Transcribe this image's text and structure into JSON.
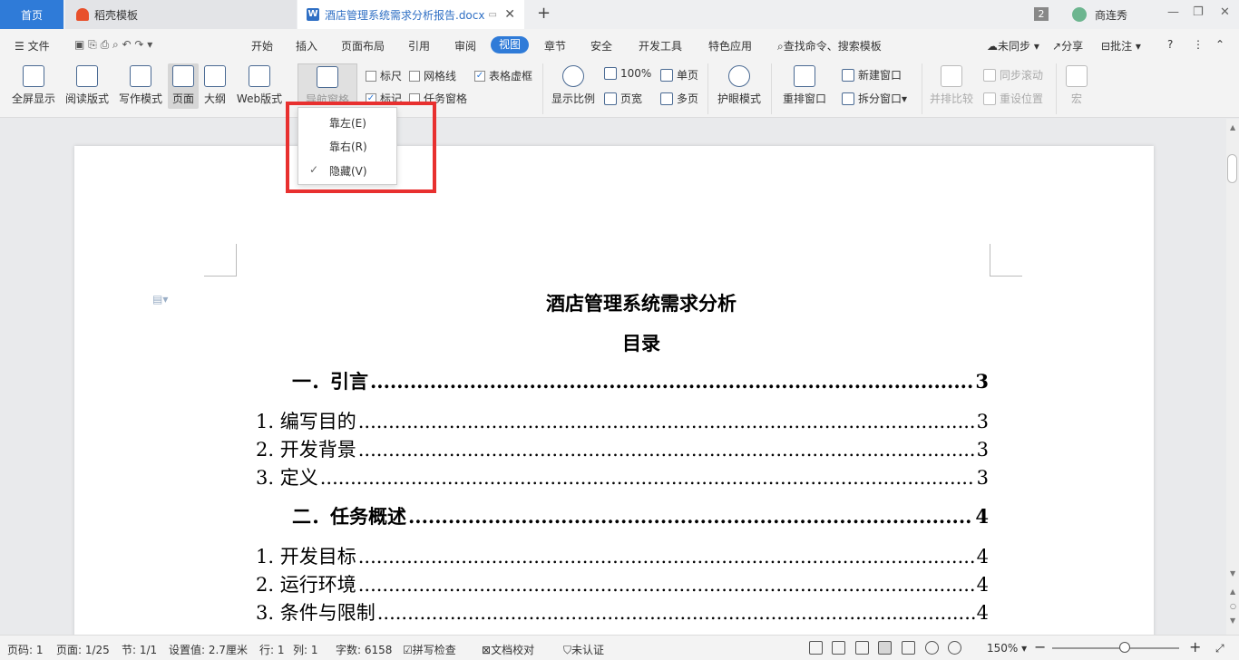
{
  "tabs": {
    "home": "首页",
    "daoke": "稻壳模板",
    "doc": "酒店管理系统需求分析报告.docx"
  },
  "window": {
    "count": "2",
    "user": "商连秀"
  },
  "menu": {
    "file": "文件",
    "items": [
      "开始",
      "插入",
      "页面布局",
      "引用",
      "审阅",
      "视图",
      "章节",
      "安全",
      "开发工具",
      "特色应用"
    ],
    "search": "查找命令、搜索模板",
    "sync": "未同步",
    "share": "分享",
    "comment": "批注"
  },
  "ribbon": {
    "fullscreen": "全屏显示",
    "reading": "阅读版式",
    "writing": "写作模式",
    "page": "页面",
    "outline": "大纲",
    "web": "Web版式",
    "nav": "导航窗格",
    "ruler": "标尺",
    "gridlines": "网格线",
    "table_gridlines": "表格虚框",
    "markup": "标记",
    "task_pane": "任务窗格",
    "zoom": "显示比例",
    "zoom_100": "100%",
    "page_width": "页宽",
    "single_page": "单页",
    "multi_page": "多页",
    "eye": "护眼模式",
    "rearrange": "重排窗口",
    "new_window": "新建窗口",
    "split_window": "拆分窗口",
    "side_by_side": "并排比较",
    "sync_scroll": "同步滚动",
    "reset_pos": "重设位置",
    "macro": "宏"
  },
  "dropdown": {
    "left": "靠左(E)",
    "right": "靠右(R)",
    "hide": "隐藏(V)"
  },
  "document": {
    "title": "酒店管理系统需求分析",
    "toc_title": "目录",
    "toc": [
      {
        "text": "一．引言",
        "page": "3",
        "level": 1
      },
      {
        "text": "1. 编写目的",
        "page": "3",
        "level": 2
      },
      {
        "text": "2. 开发背景",
        "page": "3",
        "level": 2
      },
      {
        "text": "3. 定义",
        "page": "3",
        "level": 2
      },
      {
        "text": "二．任务概述",
        "page": "4",
        "level": 1
      },
      {
        "text": "1. 开发目标",
        "page": "4",
        "level": 2
      },
      {
        "text": "2. 运行环境",
        "page": "4",
        "level": 2
      },
      {
        "text": "3. 条件与限制",
        "page": "4",
        "level": 2
      }
    ]
  },
  "status": {
    "page_no": "页码: 1",
    "pages": "页面: 1/25",
    "section": "节: 1/1",
    "setting": "设置值: 2.7厘米",
    "row": "行: 1",
    "col": "列: 1",
    "words": "字数: 6158",
    "spell": "拼写检查",
    "proof": "文档校对",
    "cert": "未认证",
    "zoom": "150%"
  },
  "colors": {
    "accent": "#2f7bd8",
    "highlight": "#e8302f"
  }
}
